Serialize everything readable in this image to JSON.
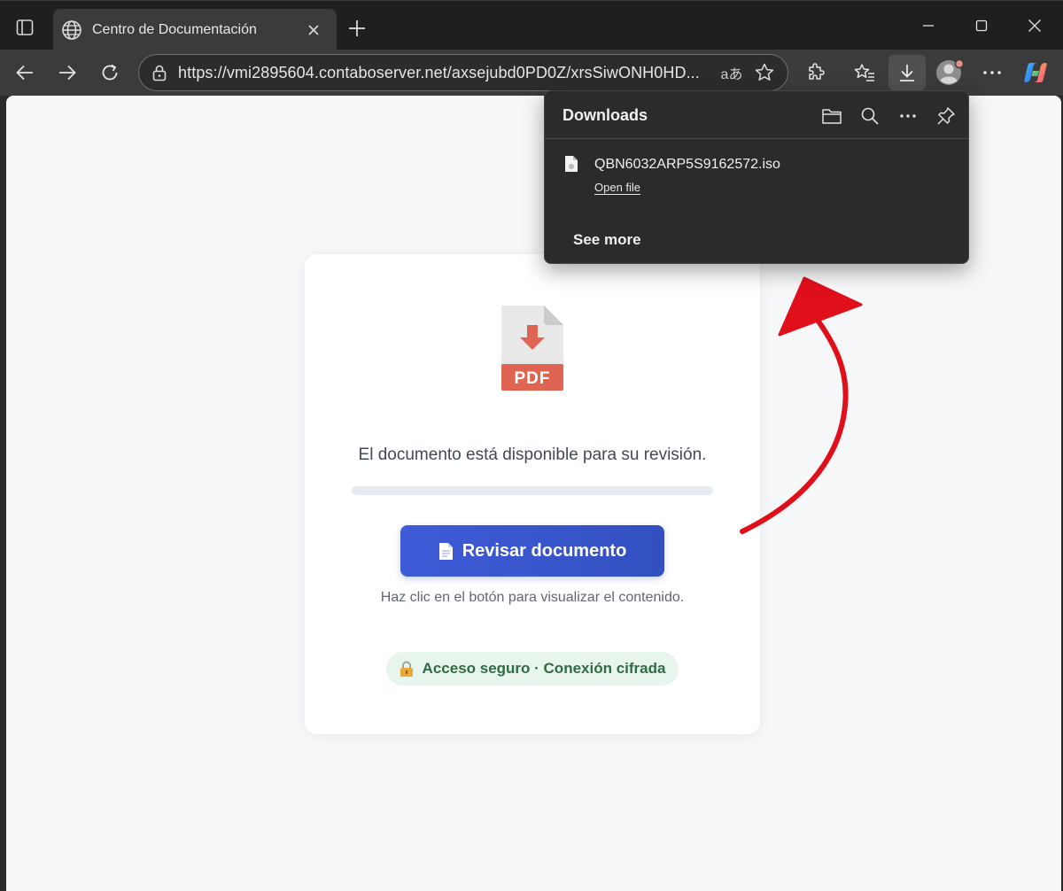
{
  "browser": {
    "tab_title": "Centro de Documentación",
    "url": "https://vmi2895604.contaboserver.net/axsejubd0PD0Z/xrsSiwONH0HD...",
    "read_aloud_label": "aあ"
  },
  "downloads": {
    "title": "Downloads",
    "file_name": "QBN6032ARP5S9162572.iso",
    "open_file_label": "Open file",
    "see_more_label": "See more"
  },
  "page": {
    "pdf_label": "PDF",
    "message": "El documento está disponible para su revisión.",
    "progress": 0,
    "review_button_label": "Revisar documento",
    "hint": "Haz clic en el botón para visualizar el contenido.",
    "secure_label": "Acceso seguro · Conexión cifrada"
  },
  "colors": {
    "button": "#3f5bd8",
    "pdf_accent": "#e06452",
    "secure_bg": "#e8f5ec",
    "secure_text": "#2f6b43",
    "annotation_arrow": "#e0101b"
  },
  "icons": [
    "sidebar-icon",
    "globe-icon",
    "close-icon",
    "plus-icon",
    "minimize-icon",
    "maximize-icon",
    "back-icon",
    "forward-icon",
    "refresh-icon",
    "lock-icon",
    "star-icon",
    "extensions-icon",
    "favorites-icon",
    "download-icon",
    "profile-icon",
    "more-icon",
    "copilot-icon",
    "folder-icon",
    "search-icon",
    "pin-icon",
    "file-icon",
    "pdf-icon",
    "document-icon",
    "padlock-icon"
  ]
}
